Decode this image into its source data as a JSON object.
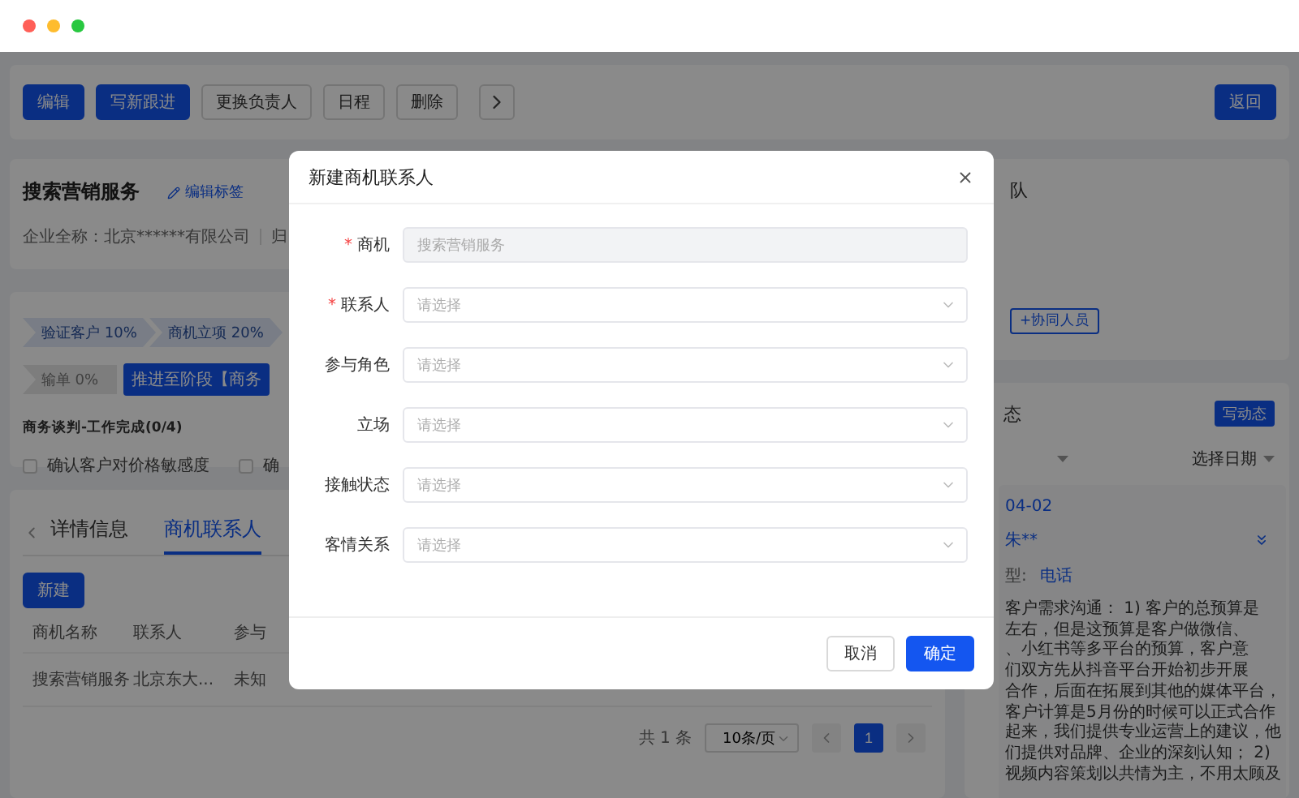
{
  "toolbar": {
    "buttons": [
      {
        "label": "编辑",
        "kind": "primary"
      },
      {
        "label": "写新跟进",
        "kind": "primary"
      },
      {
        "label": "更换负责人",
        "kind": "default"
      },
      {
        "label": "日程",
        "kind": "default"
      },
      {
        "label": "删除",
        "kind": "default"
      }
    ],
    "back_button": "返回"
  },
  "info": {
    "title": "搜索营销服务",
    "edit_tags": "编辑标签",
    "company": "企业全称：北京******有限公司",
    "owner_label": "归"
  },
  "stage": {
    "steps": [
      {
        "label": "验证客户 10%",
        "kind": "stage"
      },
      {
        "label": "商机立项 20%",
        "kind": "stage"
      },
      {
        "label": "输单 0%",
        "kind": "lost"
      }
    ],
    "advance_button": "推进至阶段【商务",
    "task_title": "商务谈判-工作完成(0/4)",
    "tasks": [
      {
        "label": "确认客户对价格敏感度",
        "checked": false
      },
      {
        "label": "确",
        "checked": false
      }
    ]
  },
  "detail_tabs": {
    "tabs": [
      {
        "label": "详情信息",
        "selected": false
      },
      {
        "label": "商机联系人",
        "selected": true
      }
    ],
    "new_button": "新建",
    "columns": [
      "商机名称",
      "联系人",
      "参与"
    ],
    "rows": [
      [
        "搜索营销服务",
        "北京东大...",
        "未知"
      ]
    ],
    "total": "共 1 条",
    "page_size": "10条/页",
    "pages": [
      {
        "label": "1",
        "selected": true
      }
    ]
  },
  "team": {
    "title": "队",
    "add_button": "+协同人员"
  },
  "dynamics": {
    "title": "态",
    "write_button": "写动态",
    "date_filter": "选择日期",
    "date": "04-02",
    "author": "朱**",
    "type_label": "型:",
    "type_value": "电话",
    "note_lines": [
      "客户需求沟通： 1) 客户的总预算是",
      "左右，但是这预算是客户做微信、",
      "、小红书等多平台的预算，客户意",
      "们双方先从抖音平台开始初步开展",
      "合作，后面在拓展到其他的媒体平台，",
      "客户计算是5月份的时候可以正式合作",
      "起来，我们提供专业运营上的建议，他",
      "们提供对品牌、企业的深刻认知； 2)",
      "视频内容策划以共情为主，不用太顾及"
    ]
  },
  "dialog": {
    "title": "新建商机联系人",
    "required_mark": "*",
    "fields": [
      {
        "label": "商机",
        "required": true,
        "kind": "input",
        "value": "搜索营销服务",
        "disabled": true
      },
      {
        "label": "联系人",
        "required": true,
        "kind": "select",
        "placeholder": "请选择",
        "disabled": false
      },
      {
        "label": "参与角色",
        "required": false,
        "kind": "select",
        "placeholder": "请选择",
        "disabled": false
      },
      {
        "label": "立场",
        "required": false,
        "kind": "select",
        "placeholder": "请选择",
        "disabled": false
      },
      {
        "label": "接触状态",
        "required": false,
        "kind": "select",
        "placeholder": "请选择",
        "disabled": false
      },
      {
        "label": "客情关系",
        "required": false,
        "kind": "select",
        "placeholder": "请选择",
        "disabled": false
      }
    ],
    "buttons": [
      {
        "label": "取消",
        "kind": "default"
      },
      {
        "label": "确定",
        "kind": "primary"
      }
    ]
  }
}
